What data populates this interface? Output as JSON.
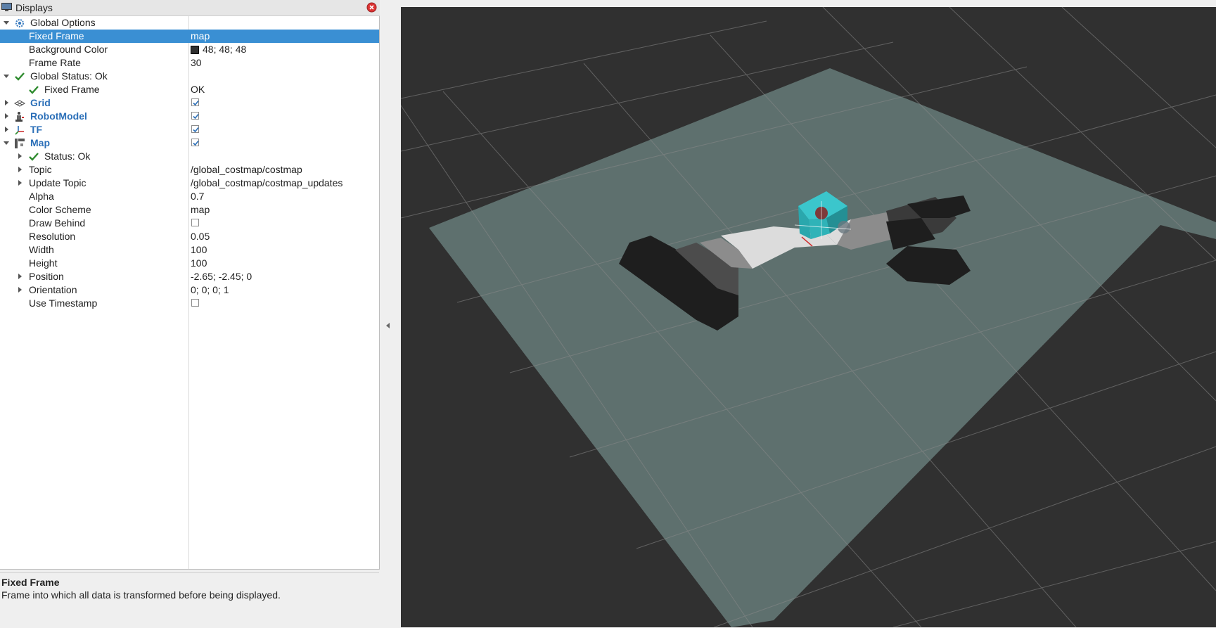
{
  "panel": {
    "title": "Displays",
    "description_title": "Fixed Frame",
    "description_text": "Frame into which all data is transformed before being displayed."
  },
  "tree": {
    "global_options": {
      "label": "Global Options"
    },
    "fixed_frame": {
      "label": "Fixed Frame",
      "value": "map"
    },
    "background_color": {
      "label": "Background Color",
      "value": "48; 48; 48",
      "color": "#303030"
    },
    "frame_rate": {
      "label": "Frame Rate",
      "value": "30"
    },
    "global_status": {
      "label": "Global Status: Ok"
    },
    "status_fixed_frame": {
      "label": "Fixed Frame",
      "value": "OK"
    },
    "grid": {
      "label": "Grid",
      "enabled": true
    },
    "robot_model": {
      "label": "RobotModel",
      "enabled": true
    },
    "tf": {
      "label": "TF",
      "enabled": true
    },
    "map": {
      "label": "Map",
      "enabled": true
    },
    "map_status": {
      "label": "Status: Ok"
    },
    "topic": {
      "label": "Topic",
      "value": "/global_costmap/costmap"
    },
    "update_topic": {
      "label": "Update Topic",
      "value": "/global_costmap/costmap_updates"
    },
    "alpha": {
      "label": "Alpha",
      "value": "0.7"
    },
    "color_scheme": {
      "label": "Color Scheme",
      "value": "map"
    },
    "draw_behind": {
      "label": "Draw Behind",
      "enabled": false
    },
    "resolution": {
      "label": "Resolution",
      "value": "0.05"
    },
    "width": {
      "label": "Width",
      "value": "100"
    },
    "height": {
      "label": "Height",
      "value": "100"
    },
    "position": {
      "label": "Position",
      "value": "-2.65; -2.45; 0"
    },
    "orientation": {
      "label": "Orientation",
      "value": "0; 0; 0; 1"
    },
    "use_timestamp": {
      "label": "Use Timestamp",
      "enabled": false
    }
  },
  "colors": {
    "selection": "#3a8fd3",
    "display_name": "#2b6fb8",
    "viewport_background": "#303030",
    "map_plane": "#5e706e",
    "robot": "#2fb3b8"
  }
}
